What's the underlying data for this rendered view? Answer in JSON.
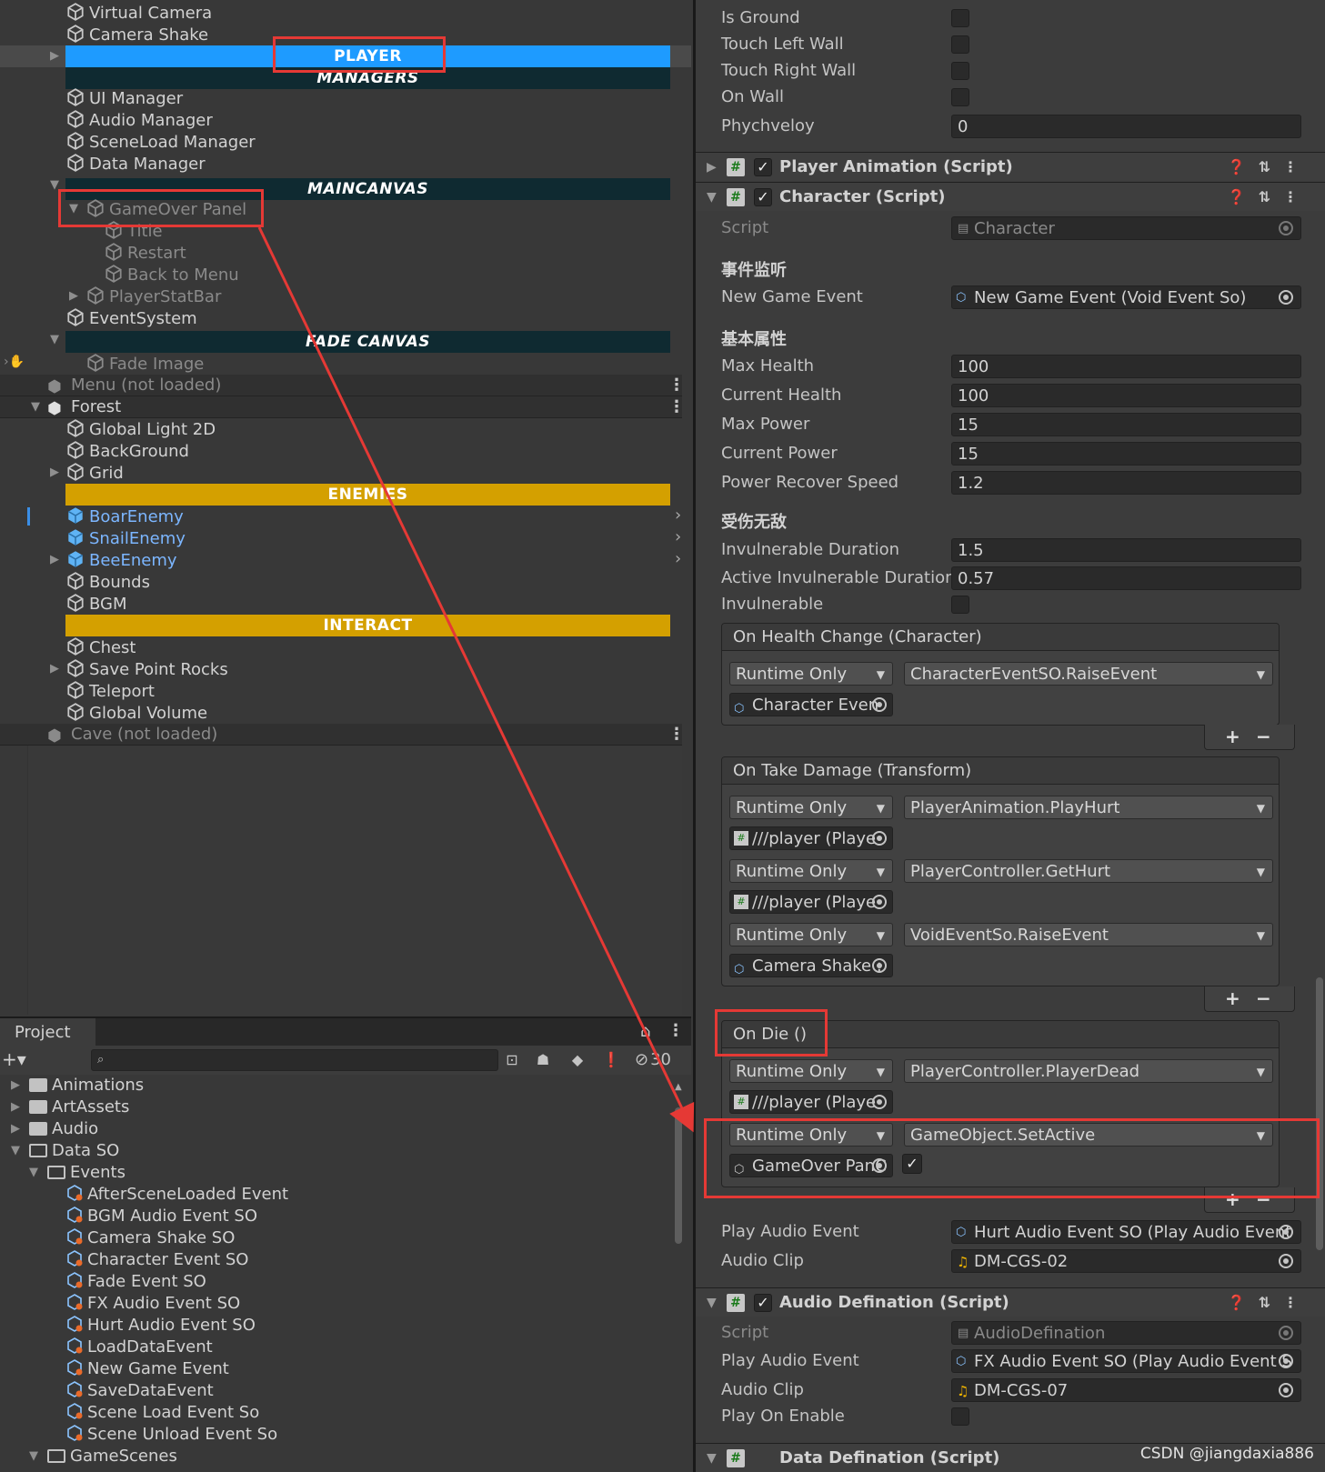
{
  "hierarchy": {
    "items_top": [
      "Virtual Camera",
      "Camera Shake"
    ],
    "separator_player": "PLAYER",
    "separator_managers": "MANAGERS",
    "managers": [
      "UI Manager",
      "Audio Manager",
      "SceneLoad Manager",
      "Data Manager"
    ],
    "separator_maincanvas": "MAINCANVAS",
    "gameover_panel": "GameOver Panel",
    "gameover_children": [
      "Title",
      "Restart",
      "Back to Menu"
    ],
    "player_stat_bar": "PlayerStatBar",
    "event_system": "EventSystem",
    "separator_fade": "FADE CANVAS",
    "fade_image": "Fade Image",
    "scene_menu": "Menu (not loaded)",
    "scene_forest": "Forest",
    "forest_items": [
      "Global Light 2D",
      "BackGround",
      "Grid"
    ],
    "separator_enemies": "ENEMIES",
    "enemies": [
      "BoarEnemy",
      "SnailEnemy",
      "BeeEnemy"
    ],
    "forest_items2": [
      "Bounds",
      "BGM"
    ],
    "separator_interact": "INTERACT",
    "interact_items": [
      "Chest",
      "Save Point Rocks",
      "Teleport",
      "Global Volume"
    ],
    "scene_cave": "Cave (not loaded)"
  },
  "project": {
    "tab_label": "Project",
    "hidden_count": "30",
    "folders": [
      {
        "name": "Animations"
      },
      {
        "name": "ArtAssets"
      },
      {
        "name": "Audio"
      },
      {
        "name": "Data SO"
      },
      {
        "name": "Events"
      }
    ],
    "events": [
      "AfterSceneLoaded Event",
      "BGM Audio Event SO",
      "Camera Shake SO",
      "Character Event SO",
      "Fade Event SO",
      "FX Audio Event SO",
      "Hurt Audio Event SO",
      "LoadDataEvent",
      "New Game Event",
      "SaveDataEvent",
      "Scene Load Event So",
      "Scene Unload Event So"
    ],
    "game_scenes": "GameScenes"
  },
  "inspector": {
    "status_fields": [
      {
        "label": "Is Ground"
      },
      {
        "label": "Touch Left Wall"
      },
      {
        "label": "Touch Right Wall"
      },
      {
        "label": "On Wall"
      }
    ],
    "phychveloy_label": "Phychveloy",
    "phychveloy_value": "0",
    "comp_player_animation": "Player Animation (Script)",
    "comp_character": "Character (Script)",
    "script_label": "Script",
    "script_value": "Character",
    "section_events": "事件监听",
    "new_game_event_label": "New Game Event",
    "new_game_event_value": "New Game Event (Void Event So)",
    "section_basic": "基本属性",
    "basic_fields": [
      {
        "label": "Max Health",
        "value": "100"
      },
      {
        "label": "Current Health",
        "value": "100"
      },
      {
        "label": "Max Power",
        "value": "15"
      },
      {
        "label": "Current Power",
        "value": "15"
      },
      {
        "label": "Power Recover Speed",
        "value": "1.2"
      }
    ],
    "section_invuln": "受伤无敌",
    "invuln_duration_label": "Invulnerable Duration",
    "invuln_duration_value": "1.5",
    "active_invuln_label": "Active Invulnerable Duration",
    "active_invuln_value": "0.57",
    "invulnerable_label": "Invulnerable",
    "on_health_change": {
      "title": "On Health Change (Character)",
      "mode": "Runtime Only",
      "func": "CharacterEventSO.RaiseEvent",
      "obj": "Character Even"
    },
    "on_take_damage": {
      "title": "On Take Damage (Transform)",
      "entries": [
        {
          "mode": "Runtime Only",
          "func": "PlayerAnimation.PlayHurt",
          "obj": "///player (Playe"
        },
        {
          "mode": "Runtime Only",
          "func": "PlayerController.GetHurt",
          "obj": "///player (Playe"
        },
        {
          "mode": "Runtime Only",
          "func": "VoidEventSo.RaiseEvent",
          "obj": "Camera Shake :"
        }
      ]
    },
    "on_die": {
      "title": "On Die ()",
      "entries": [
        {
          "mode": "Runtime Only",
          "func": "PlayerController.PlayerDead",
          "obj": "///player (Playe"
        },
        {
          "mode": "Runtime Only",
          "func": "GameObject.SetActive",
          "obj": "GameOver PanС"
        }
      ]
    },
    "play_audio_label": "Play Audio Event",
    "play_audio_value": "Hurt Audio Event SO (Play Audio Event",
    "audio_clip_label": "Audio Clip",
    "audio_clip_value": "DM-CGS-02",
    "comp_audio_def": "Audio Defination (Script)",
    "ad_script_value": "AudioDefination",
    "ad_play_audio_value": "FX Audio Event SO (Play Audio Event S",
    "ad_audio_clip_value": "DM-CGS-07",
    "play_on_enable_label": "Play On Enable",
    "comp_data_def": "Data Defination (Script)"
  },
  "watermark": "CSDN @jiangdaxia886",
  "colors": {
    "player_bar": "#1e9bff",
    "dark_bar": "#0f2a31",
    "enemies_bar": "#d4a000",
    "highlight_red": "#e53935",
    "prefab_blue": "#7cb6ff"
  }
}
